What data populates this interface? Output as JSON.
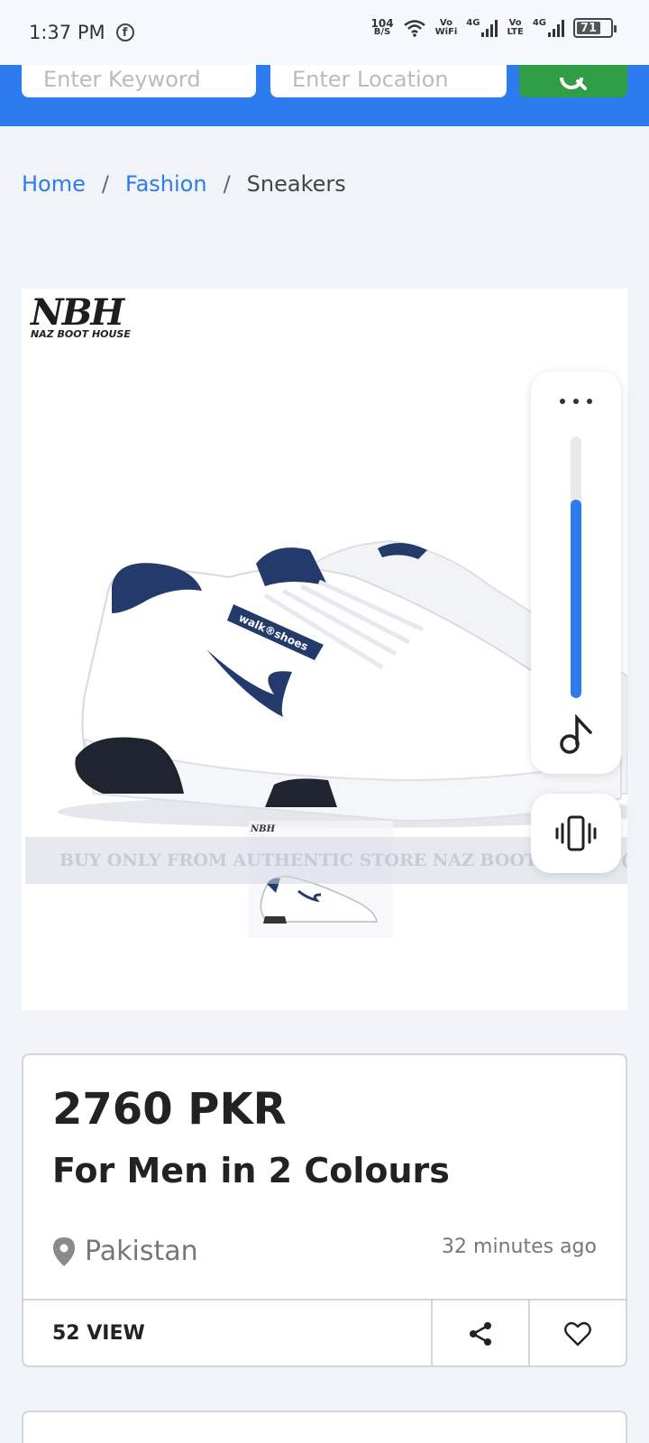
{
  "status": {
    "time": "1:37 PM",
    "net_speed_value": "104",
    "net_speed_unit": "B/S",
    "wifi_label_top": "Vo",
    "wifi_label_bottom": "WiFi",
    "sim1_type": "4G",
    "lte_label_top": "Vo",
    "lte_label_bottom": "LTE",
    "sim2_type": "4G",
    "battery": "71"
  },
  "search": {
    "keyword_placeholder": "Enter Keyword",
    "location_placeholder": "Enter Location"
  },
  "breadcrumb": {
    "home": "Home",
    "sep": "/",
    "category": "Fashion",
    "current": "Sneakers"
  },
  "photo": {
    "logo_big": "NBH",
    "logo_small": "NAZ BOOT HOUSE",
    "watermark": "BUY ONLY FROM AUTHENTIC STORE NAZ BOOT HOUSE (I",
    "shoe_label": "walk®shoes"
  },
  "volume_panel": {
    "level": 0.76
  },
  "listing": {
    "price": "2760 PKR",
    "title": "For Men in 2 Colours",
    "location": "Pakistan",
    "posted": "32 minutes ago",
    "views": "52 VIEW"
  },
  "colors": {
    "accent": "#2d7bec",
    "search_button": "#2f9e44"
  }
}
